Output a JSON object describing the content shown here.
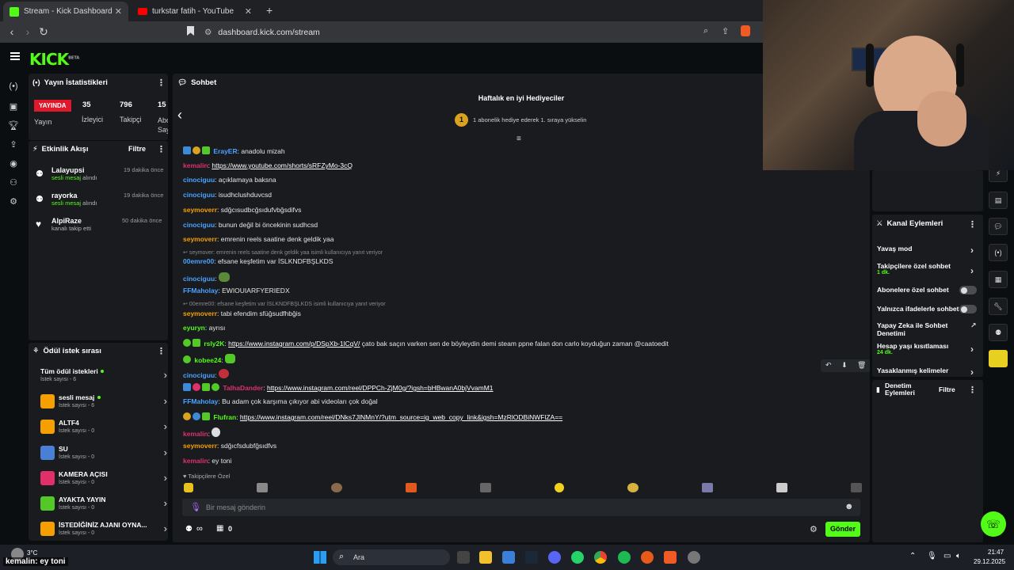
{
  "browser": {
    "tabs": [
      {
        "label": "Stream - Kick Dashboard"
      },
      {
        "label": "turkstar fatih - YouTube"
      }
    ],
    "new_tab": "+",
    "url": "dashboard.kick.com/stream"
  },
  "kick": {
    "logo": "KICK",
    "logo_sup": "BETA"
  },
  "stats": {
    "title": "Yayın İstatistikleri",
    "live_badge": "YAYINDA",
    "items": [
      {
        "value": "",
        "label": "Yayın"
      },
      {
        "value": "35",
        "label": "İzleyici"
      },
      {
        "value": "796",
        "label": "Takipçi"
      },
      {
        "value": "15",
        "label": "Abo Sayı"
      }
    ]
  },
  "activity": {
    "title": "Etkinlik Akışı",
    "filter": "Filtre",
    "items": [
      {
        "name": "Lalayupsi",
        "pre": "sesli mesaj",
        "post": " alındı",
        "time": "19 dakika önce"
      },
      {
        "name": "rayorka",
        "pre": "sesli mesaj",
        "post": " alındı",
        "time": "19 dakika önce"
      },
      {
        "name": "AlpiRaze",
        "pre": "",
        "post": "kanalı takip etti",
        "time": "50 dakika önce"
      }
    ]
  },
  "rewards": {
    "title": "Ödül istek sırası",
    "items": [
      {
        "name": "Tüm ödül istekleri",
        "sub": "İstek sayısı - 6",
        "color": "",
        "dot": true
      },
      {
        "name": "sesli mesaj",
        "sub": "İstek sayısı - 6",
        "color": "#f5a000",
        "dot": true
      },
      {
        "name": "ALTF4",
        "sub": "İstek sayısı - 0",
        "color": "#f5a000",
        "dot": false
      },
      {
        "name": "SU",
        "sub": "İstek sayısı - 0",
        "color": "#4a7fd6",
        "dot": false
      },
      {
        "name": "KAMERA AÇISI",
        "sub": "İstek sayısı - 0",
        "color": "#e0306a",
        "dot": false
      },
      {
        "name": "AYAKTA YAYIN",
        "sub": "İstek sayısı - 0",
        "color": "#53c927",
        "dot": false
      },
      {
        "name": "İSTEDİĞİNİZ AJANI OYNA...",
        "sub": "İstek sayısı - 0",
        "color": "#f5a000",
        "dot": false
      }
    ]
  },
  "chat": {
    "title": "Sohbet",
    "gifter_title": "Haftalık en iyi Hediyeciler",
    "gifter_sub": "1 abonelik hediye ederek 1. sıraya yükselin",
    "gifter_rank": "1",
    "messages": [
      {
        "user": "ErayER",
        "color": "#4aa3ff",
        "text": ": anadolu mizah",
        "link": ""
      },
      {
        "user": "kemalin",
        "color": "#e0306a",
        "text": ": ",
        "link": "https://www.youtube.com/shorts/sRFZyMo-3cQ"
      },
      {
        "user": "cinociguu",
        "color": "#4aa3ff",
        "text": ": açıklamaya baksna",
        "link": ""
      },
      {
        "user": "cinociguu",
        "color": "#4aa3ff",
        "text": ": isudhclushduvcsd",
        "link": ""
      },
      {
        "user": "seymoverr",
        "color": "#f5a000",
        "text": ": sdğcısudbcğsıdufvbğsdifvs",
        "link": ""
      },
      {
        "user": "cinociguu",
        "color": "#4aa3ff",
        "text": ": bunun değil bi öncekinin sudhcsd",
        "link": ""
      },
      {
        "user": "seymoverr",
        "color": "#f5a000",
        "text": ": emrenin reels saatine denk geldik yaa",
        "link": ""
      },
      {
        "user": "00emre00",
        "color": "#4aa3ff",
        "text": ": efsane keşfetim var İSLKNDFBŞLKDS",
        "link": ""
      },
      {
        "user": "cinociguu",
        "color": "#4aa3ff",
        "text": ":",
        "link": ""
      },
      {
        "user": "FFMaholay",
        "color": "#4aa3ff",
        "text": ": EWIOUIARFYERIEDX",
        "link": ""
      },
      {
        "user": "seymoverr",
        "color": "#f5a000",
        "text": ": tabi efendim sfüğsudfhbğis",
        "link": ""
      },
      {
        "user": "eyuryn",
        "color": "#53fc18",
        "text": ": ayrısı",
        "link": ""
      },
      {
        "user": "rsly2K",
        "color": "#53fc18",
        "text": ": ",
        "link": "https://www.instagram.com/p/DSpXb-1lCqV/",
        "after": " çato bak saçın varken sen de böyleydin demi steam ppne falan don carlo koyduğun zaman @caatoedit"
      },
      {
        "user": "kobee24",
        "color": "#53fc18",
        "text": ":",
        "link": ""
      },
      {
        "user": "cinociguu",
        "color": "#4aa3ff",
        "text": ":",
        "link": ""
      },
      {
        "user": "TalhaDander",
        "color": "#e0306a",
        "text": ": ",
        "link": "https://www.instagram.com/reel/DPPCh-ZjM0g/?igsh=bHBwanA0bjVvamM1"
      },
      {
        "user": "FFMaholay",
        "color": "#4aa3ff",
        "text": ": Bu adam çok karşıma çıkıyor abi videoları çok doğal",
        "link": ""
      },
      {
        "user": "Flufran",
        "color": "#53fc18",
        "text": ": ",
        "link": "https://www.instagram.com/reel/DNks7JlNMnY/?utm_source=ig_web_copy_link&igsh=MzRlODBiNWFlZA=="
      },
      {
        "user": "kemalin",
        "color": "#e0306a",
        "text": ":",
        "link": ""
      },
      {
        "user": "seymoverr",
        "color": "#f5a000",
        "text": ": sdğıcfsdubfğsıdfvs",
        "link": ""
      },
      {
        "user": "kemalin",
        "color": "#e0306a",
        "text": ": ey toni",
        "link": ""
      }
    ],
    "replies": [
      "seymover: emrenin reels saatine denk geldik yaa isimli kullanıcıya yanıt veriyor",
      "00emre00: efsane keşfetim var İSLKNDFBŞLKDS isimli kullanıcıya yanıt veriyor"
    ],
    "followers_only": "Takipçilere Özel",
    "input_placeholder": "Bir mesaj gönderin",
    "send": "Gönder",
    "points": "∞",
    "gift_count": "0"
  },
  "channel": {
    "title": "Kanal Eylemleri",
    "items": [
      {
        "label": "Yavaş mod",
        "sub": ""
      },
      {
        "label": "Takipçilere özel sohbet",
        "sub": "1 dk."
      },
      {
        "label": "Abonelere özel sohbet",
        "sub": ""
      },
      {
        "label": "Yalnızca ifadelerle sohbet",
        "sub": ""
      },
      {
        "label": "Yapay Zeka ile Sohbet Denetimi",
        "sub": ""
      },
      {
        "label": "Hesap yaşı kısıtlaması",
        "sub": "24 dk."
      },
      {
        "label": "Yasaklanmış kelimeler",
        "sub": ""
      }
    ],
    "moderation_title": "Denetim Eylemleri",
    "moderation_filter": "Filtre"
  },
  "overlay": {
    "text": "kemalin: ey toni"
  },
  "taskbar": {
    "weather": "3°C",
    "search": "Ara",
    "time": "21:47",
    "date": "29.12.2025"
  }
}
